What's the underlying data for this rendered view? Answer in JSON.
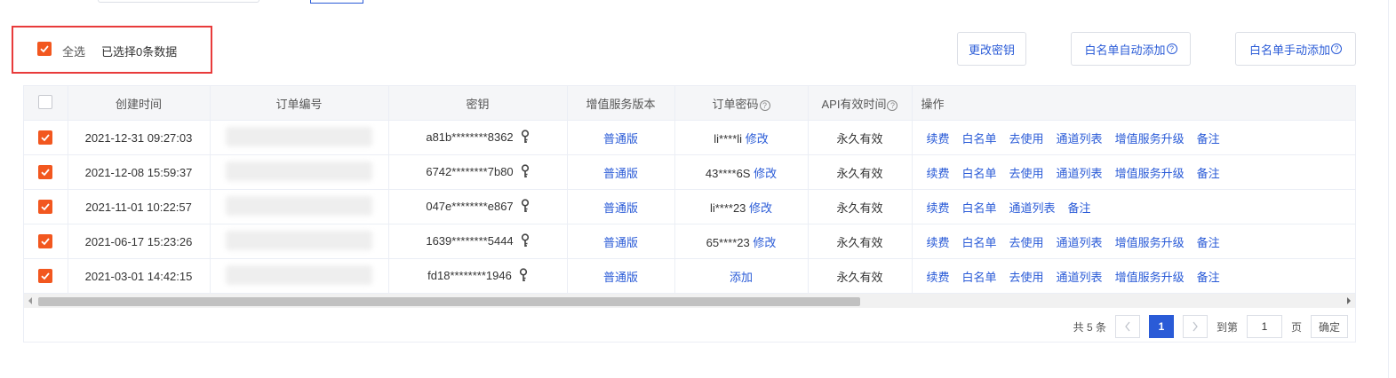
{
  "toolbar": {
    "select_all_label": "全选",
    "selected_text": "已选择0条数据",
    "change_key": "更改密钥",
    "whitelist_auto": "白名单自动添加",
    "whitelist_manual": "白名单手动添加",
    "help_glyph": "?"
  },
  "table": {
    "headers": {
      "created": "创建时间",
      "order_no": "订单编号",
      "key": "密钥",
      "version": "增值服务版本",
      "order_pwd": "订单密码",
      "api_valid": "API有效时间",
      "ops": "操作"
    },
    "rows": [
      {
        "created": "2021-12-31 09:27:03",
        "key": "a81b********8362",
        "version": "普通版",
        "pwd": "li****li",
        "pwd_action": "修改",
        "valid": "永久有效",
        "ops": [
          "续费",
          "白名单",
          "去使用",
          "通道列表",
          "增值服务升级",
          "备注"
        ]
      },
      {
        "created": "2021-12-08 15:59:37",
        "key": "6742********7b80",
        "version": "普通版",
        "pwd": "43****6S",
        "pwd_action": "修改",
        "valid": "永久有效",
        "ops": [
          "续费",
          "白名单",
          "去使用",
          "通道列表",
          "增值服务升级",
          "备注"
        ]
      },
      {
        "created": "2021-11-01 10:22:57",
        "key": "047e********e867",
        "version": "普通版",
        "pwd": "li****23",
        "pwd_action": "修改",
        "valid": "永久有效",
        "ops": [
          "续费",
          "白名单",
          "通道列表",
          "备注"
        ]
      },
      {
        "created": "2021-06-17 15:23:26",
        "key": "1639********5444",
        "version": "普通版",
        "pwd": "65****23",
        "pwd_action": "修改",
        "valid": "永久有效",
        "ops": [
          "续费",
          "白名单",
          "去使用",
          "通道列表",
          "增值服务升级",
          "备注"
        ]
      },
      {
        "created": "2021-03-01 14:42:15",
        "key": "fd18********1946",
        "version": "普通版",
        "pwd": "",
        "pwd_action": "添加",
        "valid": "永久有效",
        "ops": [
          "续费",
          "白名单",
          "去使用",
          "通道列表",
          "增值服务升级",
          "备注"
        ]
      }
    ]
  },
  "pagination": {
    "total": "共 5 条",
    "current": "1",
    "goto": "到第",
    "goto_value": "1",
    "page_unit": "页",
    "confirm": "确定"
  },
  "colors": {
    "accent": "#2a5bd7",
    "checkbox": "#f2571f",
    "highlight_border": "#e83b3b"
  }
}
